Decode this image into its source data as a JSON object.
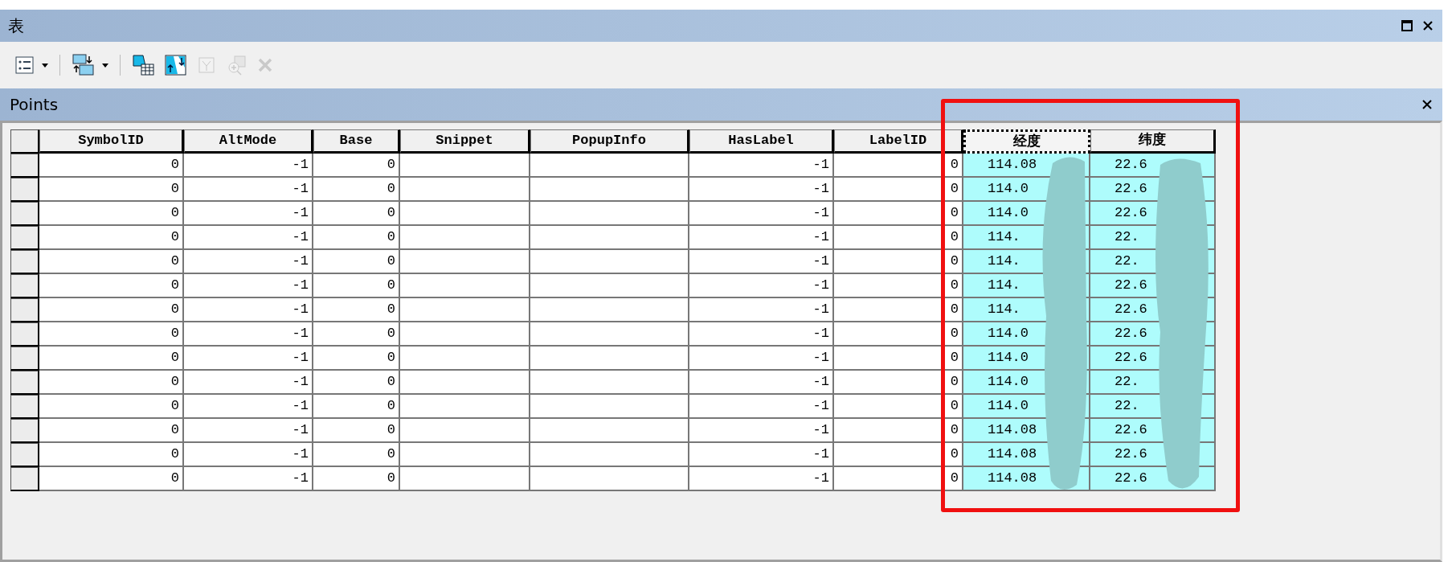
{
  "window": {
    "title": "表"
  },
  "toolbar": [
    {
      "kind": "table-options",
      "disabled": false,
      "dropdown": true
    },
    {
      "kind": "related-tables",
      "disabled": false,
      "dropdown": true
    },
    {
      "kind": "select-by-attributes",
      "disabled": false,
      "dropdown": false
    },
    {
      "kind": "switch-selection",
      "disabled": false,
      "dropdown": false
    },
    {
      "kind": "clear-selection",
      "disabled": true,
      "dropdown": false
    },
    {
      "kind": "zoom-to-selected",
      "disabled": true,
      "dropdown": false
    },
    {
      "kind": "delete-selected",
      "disabled": true,
      "dropdown": false
    }
  ],
  "table": {
    "name": "Points",
    "columns": [
      {
        "label": "SymbolID",
        "selected": false,
        "focused": false
      },
      {
        "label": "AltMode",
        "selected": false,
        "focused": false
      },
      {
        "label": "Base",
        "selected": false,
        "focused": false
      },
      {
        "label": "Snippet",
        "selected": false,
        "focused": false
      },
      {
        "label": "PopupInfo",
        "selected": false,
        "focused": false
      },
      {
        "label": "HasLabel",
        "selected": false,
        "focused": false
      },
      {
        "label": "LabelID",
        "selected": false,
        "focused": false
      },
      {
        "label": "经度",
        "selected": true,
        "focused": true
      },
      {
        "label": "纬度",
        "selected": true,
        "focused": false
      }
    ],
    "rows": [
      {
        "cells": [
          "0",
          "-1",
          "0",
          null,
          null,
          "-1",
          "0",
          "114.08",
          "22.6"
        ]
      },
      {
        "cells": [
          "0",
          "-1",
          "0",
          null,
          null,
          "-1",
          "0",
          "114.0",
          "22.6"
        ]
      },
      {
        "cells": [
          "0",
          "-1",
          "0",
          null,
          null,
          "-1",
          "0",
          "114.0",
          "22.6"
        ]
      },
      {
        "cells": [
          "0",
          "-1",
          "0",
          null,
          null,
          "-1",
          "0",
          "114.",
          "22."
        ]
      },
      {
        "cells": [
          "0",
          "-1",
          "0",
          null,
          null,
          "-1",
          "0",
          "114.",
          "22."
        ]
      },
      {
        "cells": [
          "0",
          "-1",
          "0",
          null,
          null,
          "-1",
          "0",
          "114.",
          "22.6"
        ]
      },
      {
        "cells": [
          "0",
          "-1",
          "0",
          null,
          null,
          "-1",
          "0",
          "114.",
          "22.6"
        ]
      },
      {
        "cells": [
          "0",
          "-1",
          "0",
          null,
          null,
          "-1",
          "0",
          "114.0",
          "22.6"
        ]
      },
      {
        "cells": [
          "0",
          "-1",
          "0",
          null,
          null,
          "-1",
          "0",
          "114.0",
          "22.6"
        ]
      },
      {
        "cells": [
          "0",
          "-1",
          "0",
          null,
          null,
          "-1",
          "0",
          "114.0",
          "22."
        ]
      },
      {
        "cells": [
          "0",
          "-1",
          "0",
          null,
          null,
          "-1",
          "0",
          "114.0",
          "22."
        ]
      },
      {
        "cells": [
          "0",
          "-1",
          "0",
          null,
          null,
          "-1",
          "0",
          "114.08",
          "22.6"
        ]
      },
      {
        "cells": [
          "0",
          "-1",
          "0",
          null,
          null,
          "-1",
          "0",
          "114.08",
          "22.6"
        ]
      },
      {
        "cells": [
          "0",
          "-1",
          "0",
          null,
          null,
          "-1",
          "0",
          "114.08",
          "22.6"
        ]
      }
    ]
  }
}
